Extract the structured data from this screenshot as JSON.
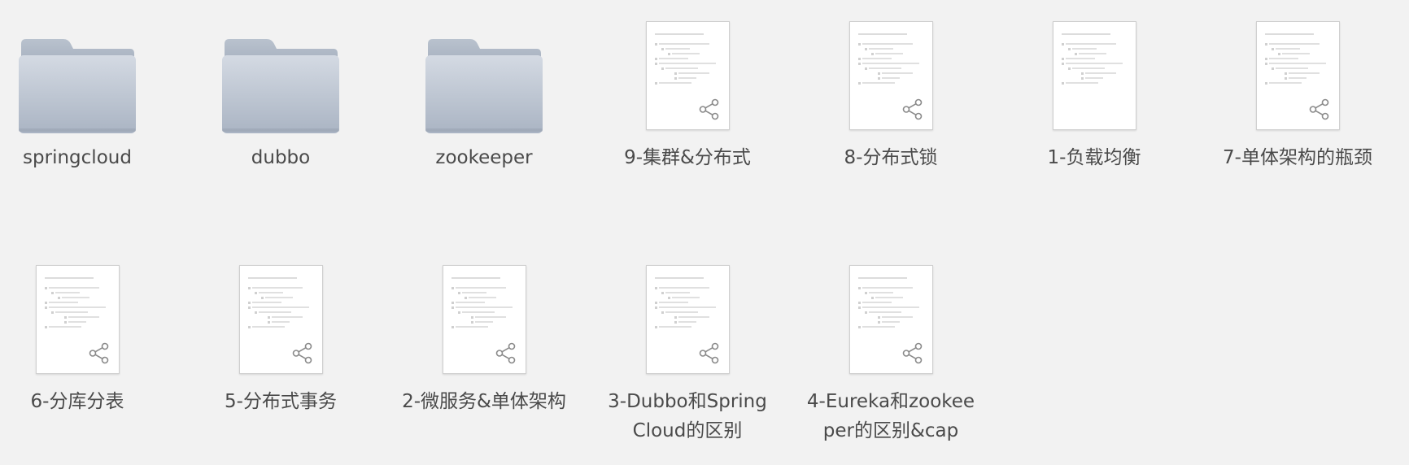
{
  "folders": [
    {
      "name": "springcloud"
    },
    {
      "name": "dubbo"
    },
    {
      "name": "zookeeper"
    }
  ],
  "files_row1": [
    {
      "name": "9-集群&分布式",
      "shared": true
    },
    {
      "name": "8-分布式锁",
      "shared": true
    },
    {
      "name": "1-负载均衡",
      "shared": false
    },
    {
      "name": "7-单体架构的瓶颈",
      "shared": true
    }
  ],
  "files_row2": [
    {
      "name": "6-分库分表",
      "shared": true
    },
    {
      "name": "5-分布式事务",
      "shared": true
    },
    {
      "name": "2-微服务&单体架构",
      "shared": true
    },
    {
      "name": "3-Dubbo和SpringCloud的区别",
      "shared": true
    },
    {
      "name": "4-Eureka和zookeeper的区别&cap",
      "shared": true
    }
  ],
  "colors": {
    "background": "#f2f2f2",
    "folder_top": "#d4dae3",
    "folder_bottom": "#aab4c3",
    "label_text": "#4a4a4a",
    "share_icon": "#8a8a8a"
  },
  "icons": {
    "folder": "folder-icon",
    "document": "document-thumbnail-icon",
    "share": "share-icon"
  }
}
